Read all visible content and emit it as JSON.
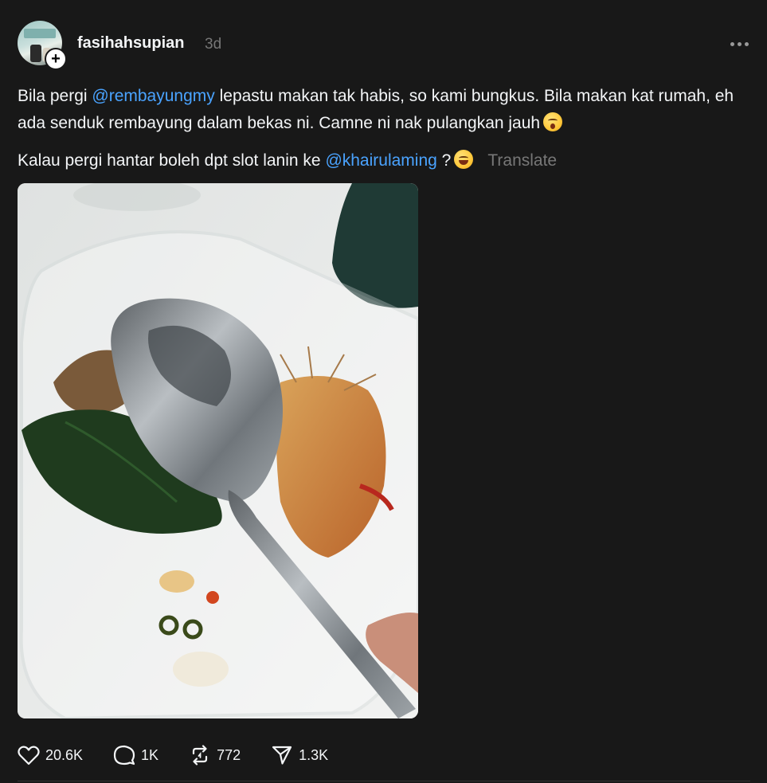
{
  "post": {
    "username": "fasihahsupian",
    "time": "3d",
    "caption_line1_parts": {
      "a": "Bila pergi ",
      "mention": "@rembayungmy",
      "b": " lepastu makan tak habis, so kami bungkus. Bila makan kat rumah, eh ada senduk rembayung dalam bekas ni. Camne ni nak pulangkan jauh"
    },
    "caption_line2_parts": {
      "a": "Kalau pergi hantar boleh dpt slot lanin ke ",
      "mention": "@khairulaming",
      "b": " ?"
    },
    "translate_label": "Translate",
    "emojis": [
      "dizzy-face-emoji",
      "laughing-face-emoji"
    ]
  },
  "actions": {
    "likes": "20.6K",
    "comments": "1K",
    "reposts": "772",
    "shares": "1.3K"
  },
  "colors": {
    "background": "#181818",
    "text": "#f3f5f7",
    "muted": "#777777",
    "mention": "#4aa3ff"
  }
}
